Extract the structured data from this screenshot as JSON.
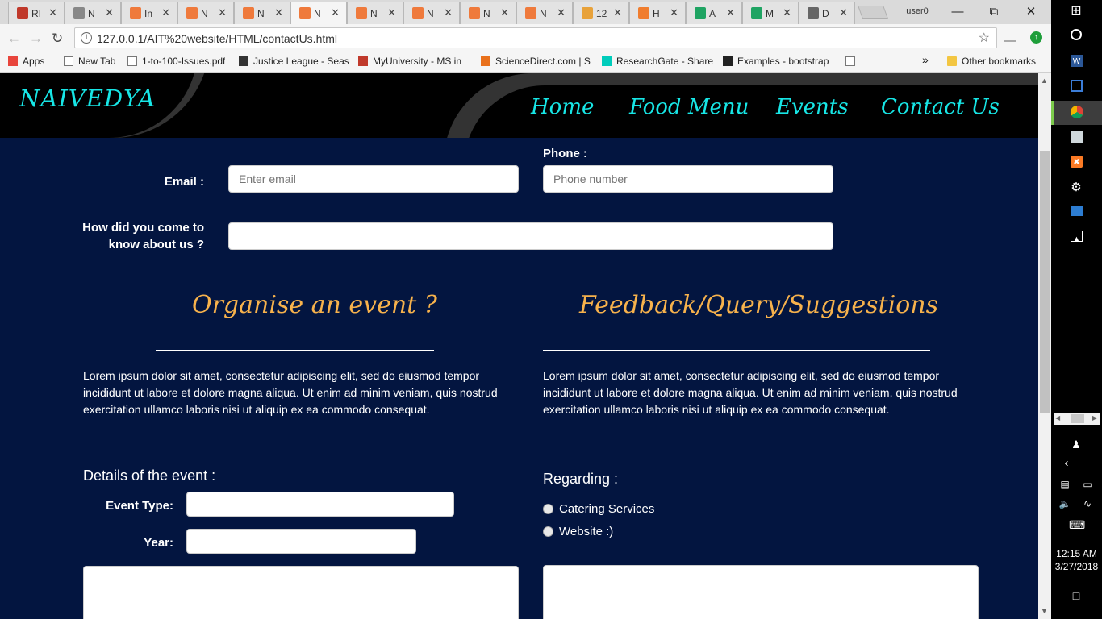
{
  "tabs": [
    {
      "label": "RI",
      "color": "#c0392b"
    },
    {
      "label": "N",
      "color": "#888888"
    },
    {
      "label": "In",
      "color": "#ef7a3c"
    },
    {
      "label": "N",
      "color": "#ef7a3c"
    },
    {
      "label": "N",
      "color": "#ef7a3c"
    },
    {
      "label": "N",
      "color": "#ef7a3c"
    },
    {
      "label": "N",
      "color": "#ef7a3c"
    },
    {
      "label": "N",
      "color": "#ef7a3c"
    },
    {
      "label": "N",
      "color": "#ef7a3c"
    },
    {
      "label": "N",
      "color": "#ef7a3c"
    },
    {
      "label": "12",
      "color": "#e8a23a"
    },
    {
      "label": "H",
      "color": "#f07d2e"
    },
    {
      "label": "A",
      "color": "#1fa463"
    },
    {
      "label": "M",
      "color": "#1fa463"
    },
    {
      "label": "D",
      "color": "#666666"
    }
  ],
  "profile": "user0",
  "address": {
    "url": "127.0.0.1/AIT%20website/HTML/contactUs.html"
  },
  "bookmarks": [
    {
      "label": "Apps",
      "icon": "apps-grid-icon"
    },
    {
      "label": "New Tab",
      "icon": "page-icon"
    },
    {
      "label": "1-to-100-Issues.pdf",
      "icon": "page-icon"
    },
    {
      "label": "Justice League - Seas",
      "icon": "monitor-icon"
    },
    {
      "label": "MyUniversity - MS in",
      "icon": "x-logo-icon"
    },
    {
      "label": "ScienceDirect.com | S",
      "icon": "elsevier-icon"
    },
    {
      "label": "ResearchGate - Share",
      "icon": "researchgate-icon"
    },
    {
      "label": "Examples - bootstrap",
      "icon": "book-icon"
    },
    {
      "label": "",
      "icon": "page-icon"
    }
  ],
  "bookmarks_overflow": "»",
  "other_bookmarks": "Other bookmarks",
  "site": {
    "brand": "NAIVEDYA",
    "nav": [
      "Home",
      "Food Menu",
      "Events",
      "Contact Us"
    ]
  },
  "form": {
    "phone_label": "Phone :",
    "phone_placeholder": "Phone number",
    "email_label": "Email :",
    "email_placeholder": "Enter email",
    "referral_label": "How did you come to know about us ?"
  },
  "organise": {
    "heading": "Organise an event ?",
    "text": "Lorem ipsum dolor sit amet, consectetur adipiscing elit, sed do eiusmod tempor incididunt ut labore et dolore magna aliqua. Ut enim ad minim veniam, quis nostrud exercitation ullamco laboris nisi ut aliquip ex ea commodo consequat.",
    "details_label": "Details of the event :",
    "event_type_label": "Event Type:",
    "year_label": "Year:"
  },
  "feedback": {
    "heading": "Feedback/Query/Suggestions",
    "text": "Lorem ipsum dolor sit amet, consectetur adipiscing elit, sed do eiusmod tempor incididunt ut labore et dolore magna aliqua. Ut enim ad minim veniam, quis nostrud exercitation ullamco laboris nisi ut aliquip ex ea commodo consequat.",
    "regarding_label": "Regarding :",
    "options": [
      "Catering Services",
      "Website :)"
    ]
  },
  "colors": {
    "page_bg": "#031540",
    "accent_cyan": "#17e6e6",
    "heading_orange": "#f7b24c"
  },
  "taskbar": {
    "time": "12:15 AM",
    "date": "3/27/2018"
  }
}
